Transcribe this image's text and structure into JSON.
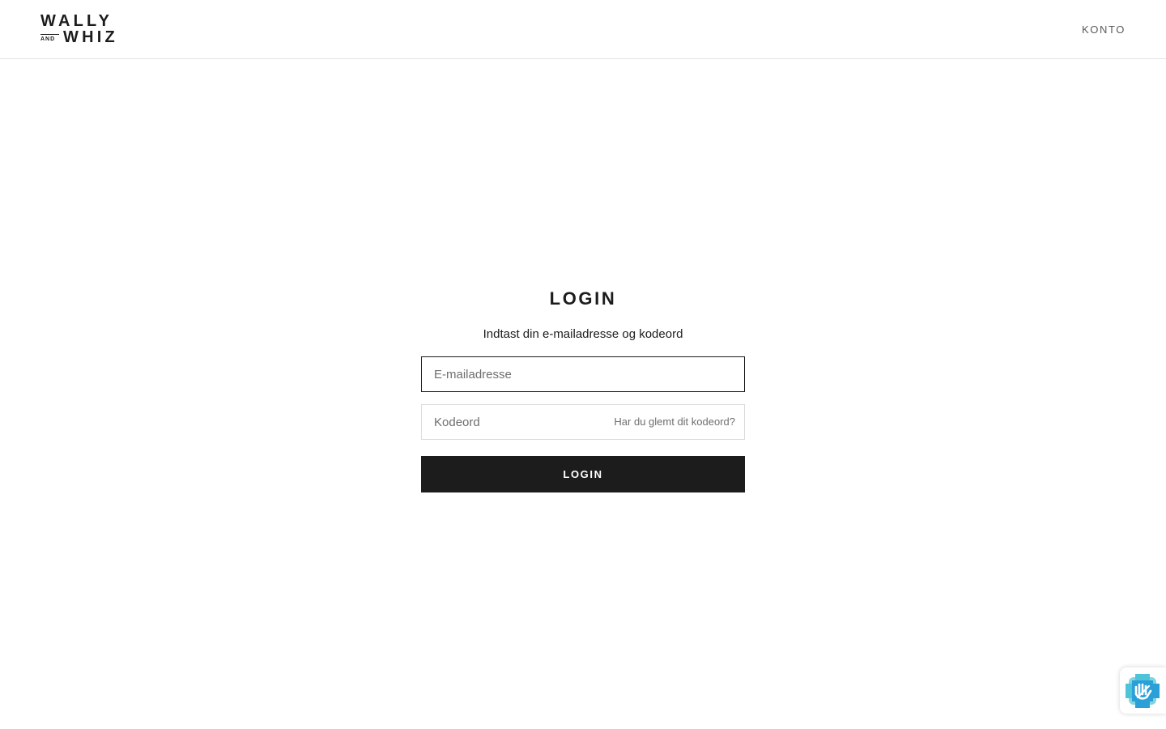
{
  "header": {
    "logo": {
      "line1": "WALLY",
      "and": "AND",
      "line2": "WHIZ"
    },
    "account_label": "KONTO"
  },
  "login": {
    "title": "LOGIN",
    "subtitle": "Indtast din e-mailadresse og kodeord",
    "email_placeholder": "E-mailadresse",
    "password_placeholder": "Kodeord",
    "forgot_label": "Har du glemt dit kodeord?",
    "submit_label": "LOGIN"
  },
  "privacy_badge": {
    "icon": "privacy-hand-icon",
    "colors": [
      "#2a9fd8",
      "#4fc3d9",
      "#7fd6de"
    ]
  }
}
